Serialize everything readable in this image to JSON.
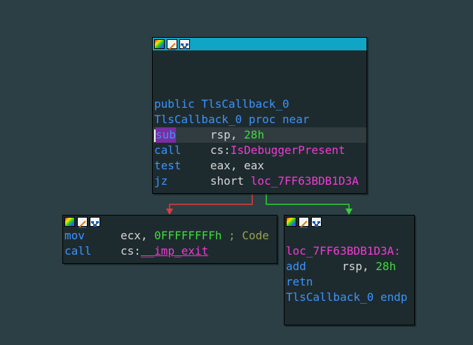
{
  "nodes": {
    "main": {
      "header": [
        "public TlsCallback_0",
        "TlsCallback_0 proc near"
      ],
      "instructions": [
        {
          "mnemonic": "sub",
          "op1": "rsp, ",
          "op2": "28h"
        },
        {
          "mnemonic": "call",
          "op1": "cs:",
          "op2": "IsDebuggerPresent"
        },
        {
          "mnemonic": "test",
          "op1": "eax, eax"
        },
        {
          "mnemonic": "jz",
          "op1": "short ",
          "op2": "loc_7FF63BDB1D3A"
        }
      ]
    },
    "left": {
      "instructions": [
        {
          "mnemonic": "mov",
          "op1": "ecx, ",
          "op2": "0FFFFFFFFh",
          "comment": " ; Code"
        },
        {
          "mnemonic": "call",
          "op1": "cs:",
          "op2": "__imp_exit"
        }
      ]
    },
    "right": {
      "label": "loc_7FF63BDB1D3A:",
      "instructions": [
        {
          "mnemonic": "add",
          "op1": "rsp, ",
          "op2": "28h"
        },
        {
          "mnemonic": "retn"
        }
      ],
      "footer": "TlsCallback_0 endp"
    }
  },
  "icons": [
    "color-palette-icon",
    "rename-icon",
    "graph-view-icon"
  ],
  "colors": {
    "background": "#2c3f45",
    "node_bg": "#1e2b2e",
    "titlebar_active": "#10a5c4",
    "edge_false": "#e03c3c",
    "edge_true": "#32d232",
    "mnemonic": "#3c93ff",
    "number": "#3fdc3f",
    "symbol": "#f23bd6"
  }
}
